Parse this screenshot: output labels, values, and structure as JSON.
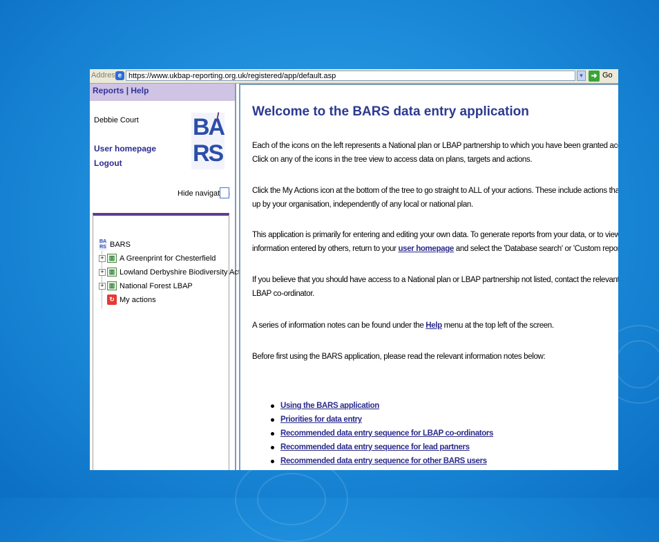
{
  "browser": {
    "address_label": "Address",
    "url": "https://www.ukbap-reporting.org.uk/registered/app/default.asp",
    "go_label": "Go"
  },
  "nav": {
    "menu": {
      "reports": "Reports",
      "separator": "|",
      "help": "Help"
    },
    "user_name": "Debbie Court",
    "links": {
      "user_homepage": "User homepage",
      "logout": "Logout"
    },
    "logo": {
      "line1": "BA",
      "line2": "RS",
      "mark": "/"
    },
    "hide_navigation_label": "Hide navigation",
    "tree": {
      "root": {
        "icon_text": "BA RS",
        "label": "BARS"
      },
      "items": [
        {
          "label": "A Greenprint for Chesterfield",
          "icon": "plan-icon"
        },
        {
          "label": "Lowland Derbyshire Biodiversity Action...",
          "icon": "plan-icon"
        },
        {
          "label": "National Forest LBAP",
          "icon": "plan-icon"
        },
        {
          "label": "My actions",
          "icon": "actions-icon"
        }
      ]
    }
  },
  "main": {
    "title": "Welcome to the BARS data entry application",
    "p1_l1": "Each of the icons on the left represents a National plan or LBAP partnership to which you have been granted access rights.",
    "p1_l2": "Click on any of the icons in the tree view to access data on plans, targets and actions.",
    "p2_l1": "Click the My Actions icon at the bottom of the tree to go straight to ALL of your actions. These include actions that have been set",
    "p2_l2": "up by your organisation, independently of any local or national plan.",
    "p3_l1": "This application is primarily for entering and editing your own data. To generate reports from your data, or to view the",
    "p3_l2_a": "information entered by others, return to your ",
    "p3_link": "user homepage",
    "p3_l2_b": " and select the 'Database search' or 'Custom reports' options.",
    "p4_l1": "If you believe that you should have access to a National plan or LBAP partnership not listed, contact the relevant Lead partner or",
    "p4_l2": "LBAP co-ordinator.",
    "p5_a": "A series of information notes can be found under the ",
    "p5_link": "Help",
    "p5_b": " menu at the top left of the screen.",
    "p6": "Before first using the BARS application, please read the relevant information notes below:",
    "notes": [
      "Using the BARS application",
      "Priorities for data entry",
      "Recommended data entry sequence for LBAP co-ordinators",
      "Recommended data entry sequence for lead partners",
      "Recommended data entry sequence for other BARS users"
    ]
  }
}
